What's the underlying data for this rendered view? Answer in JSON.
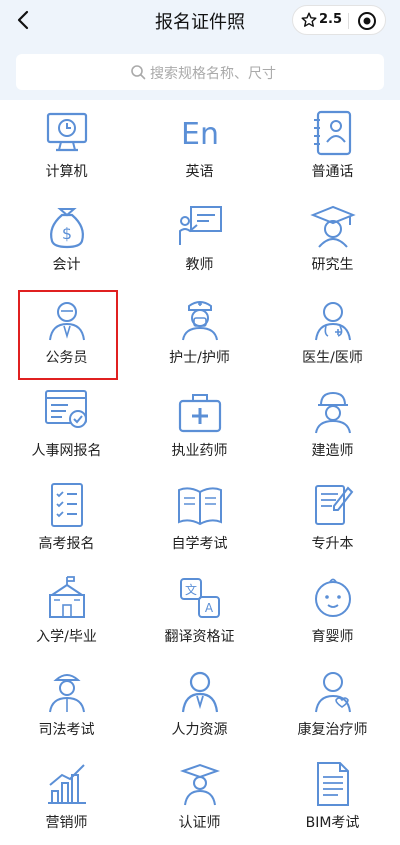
{
  "header": {
    "title": "报名证件照",
    "rating": "2.5"
  },
  "search": {
    "placeholder": "搜索规格名称、尺寸"
  },
  "grid": {
    "items": [
      {
        "label": "计算机",
        "icon": "computer-icon"
      },
      {
        "label": "英语",
        "icon": "english-icon"
      },
      {
        "label": "普通话",
        "icon": "mandarin-icon"
      },
      {
        "label": "会计",
        "icon": "money-bag-icon"
      },
      {
        "label": "教师",
        "icon": "teacher-icon"
      },
      {
        "label": "研究生",
        "icon": "graduate-icon"
      },
      {
        "label": "公务员",
        "icon": "civil-servant-icon"
      },
      {
        "label": "护士/护师",
        "icon": "nurse-icon"
      },
      {
        "label": "医生/医师",
        "icon": "doctor-icon"
      },
      {
        "label": "人事网报名",
        "icon": "web-registration-icon"
      },
      {
        "label": "执业药师",
        "icon": "medical-kit-icon"
      },
      {
        "label": "建造师",
        "icon": "builder-icon"
      },
      {
        "label": "高考报名",
        "icon": "checklist-icon"
      },
      {
        "label": "自学考试",
        "icon": "open-book-icon"
      },
      {
        "label": "专升本",
        "icon": "certificate-icon"
      },
      {
        "label": "入学/毕业",
        "icon": "school-icon"
      },
      {
        "label": "翻译资格证",
        "icon": "translate-icon"
      },
      {
        "label": "育婴师",
        "icon": "baby-icon"
      },
      {
        "label": "司法考试",
        "icon": "judge-icon"
      },
      {
        "label": "人力资源",
        "icon": "person-icon"
      },
      {
        "label": "康复治疗师",
        "icon": "therapist-icon"
      },
      {
        "label": "营销师",
        "icon": "chart-icon"
      },
      {
        "label": "认证师",
        "icon": "scholar-icon"
      },
      {
        "label": "BIM考试",
        "icon": "document-icon"
      }
    ]
  },
  "colors": {
    "accent": "#5b8fd6",
    "header_bg": "#eef4fb",
    "highlight_border": "#e02020"
  }
}
